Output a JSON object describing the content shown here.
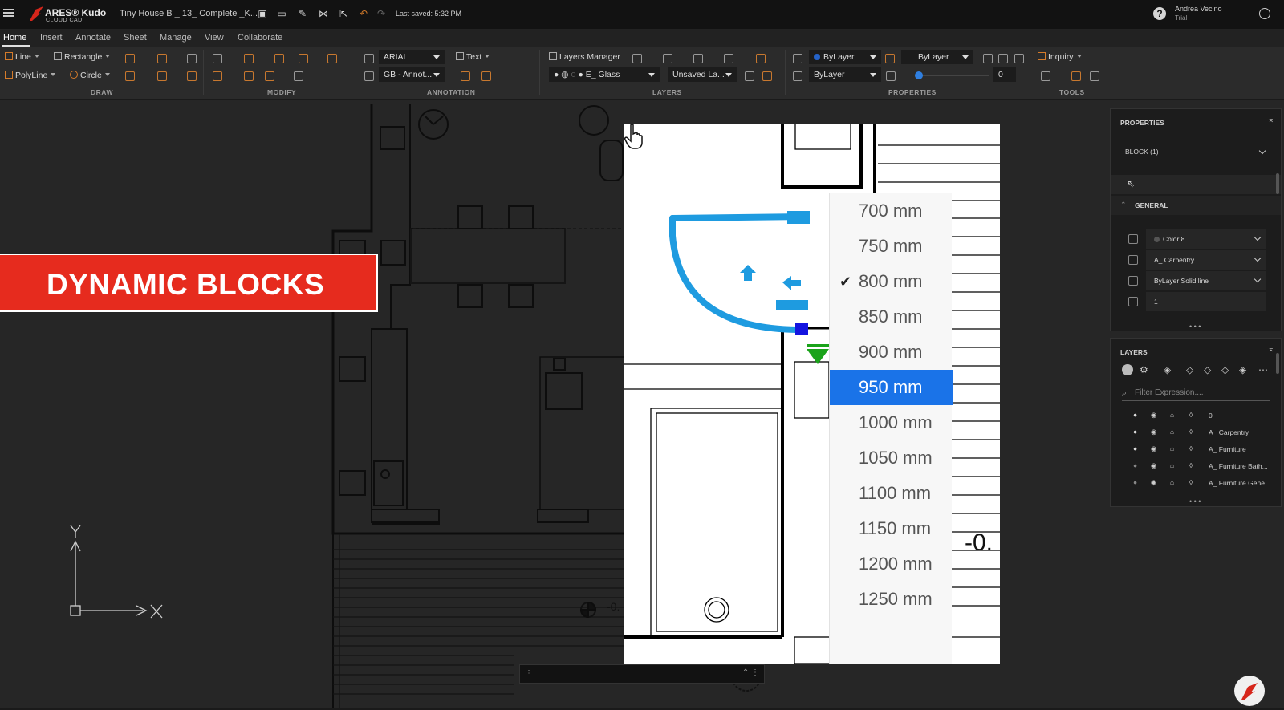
{
  "app": {
    "brand": "ARES® Kudo",
    "brand_sub": "CLOUD CAD",
    "doc_title": "Tiny House B _ 13_ Complete _K...",
    "last_saved": "Last saved: 5:32 PM",
    "user_name": "Andrea Vecino",
    "user_plan": "Trial"
  },
  "ribbon_tabs": [
    "Home",
    "Insert",
    "Annotate",
    "Sheet",
    "Manage",
    "View",
    "Collaborate"
  ],
  "ribbon": {
    "draw": {
      "line": "Line",
      "rectangle": "Rectangle",
      "polyline": "PolyLine",
      "circle": "Circle",
      "group": "DRAW"
    },
    "modify": {
      "group": "MODIFY"
    },
    "annotation": {
      "font": "ARIAL",
      "text": "Text",
      "dimstyle": "GB - Annot...",
      "group": "ANNOTATION"
    },
    "layers": {
      "manager": "Layers Manager",
      "current_layer": "E_ Glass",
      "saved_state": "Unsaved La...",
      "group": "LAYERS"
    },
    "properties": {
      "color": "ByLayer",
      "linetype": "ByLayer",
      "lineweight": "ByLayer",
      "transparency": "0",
      "group": "PROPERTIES"
    },
    "tools": {
      "inquiry": "Inquiry",
      "group": "TOOLS"
    }
  },
  "banner": {
    "text": "DYNAMIC BLOCKS"
  },
  "zoom_view": {
    "dim_label": "-0.",
    "options": [
      "700 mm",
      "750 mm",
      "800 mm",
      "850 mm",
      "900 mm",
      "950 mm",
      "1000 mm",
      "1050 mm",
      "1100 mm",
      "1150 mm",
      "1200 mm",
      "1250 mm"
    ],
    "checked_option": "800 mm",
    "highlighted_option": "950 mm",
    "highlight_color": "#1a73e8",
    "block_color": "#1e9be0"
  },
  "canvas": {
    "dim_label": "-0.",
    "ucs_y": "Y",
    "ucs_x": "X"
  },
  "properties_panel": {
    "title": "PROPERTIES",
    "selection": "BLOCK (1)",
    "section": "GENERAL",
    "color": "Color 8",
    "layer": "A_ Carpentry",
    "linetype": "ByLayer Solid line",
    "value": "1"
  },
  "layers_panel": {
    "title": "LAYERS",
    "filter_placeholder": "Filter Expression....",
    "layers": [
      "0",
      "A_ Carpentry",
      "A_ Furniture",
      "A_ Furniture Bath...",
      "A_ Furniture Gene..."
    ]
  },
  "accent": "#e62b1e"
}
